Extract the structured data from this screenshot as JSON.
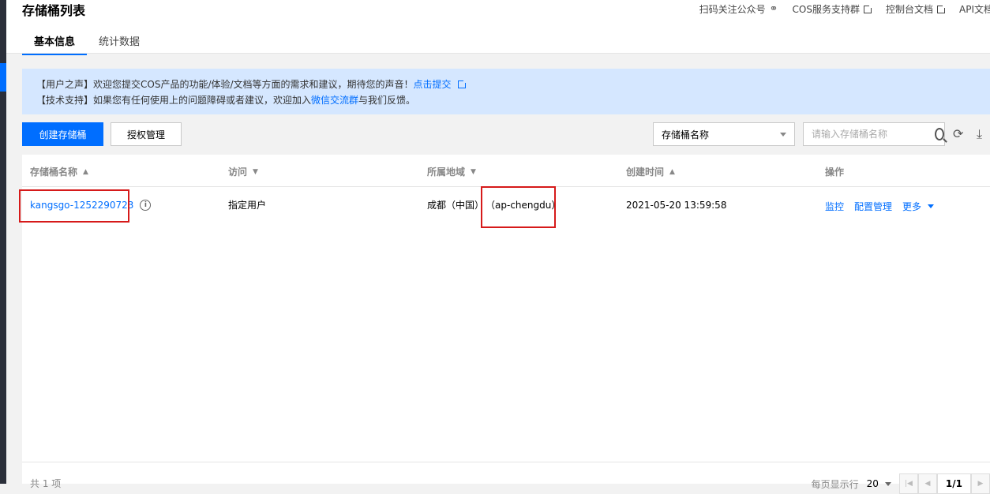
{
  "header": {
    "title": "存储桶列表",
    "links": [
      {
        "label": "扫码关注公众号",
        "icon": "wechat-icon"
      },
      {
        "label": "COS服务支持群",
        "icon": "external-link-icon"
      },
      {
        "label": "控制台文档",
        "icon": "external-link-icon"
      },
      {
        "label": "API文档",
        "icon": ""
      }
    ],
    "tabs": [
      {
        "label": "基本信息",
        "active": true
      },
      {
        "label": "统计数据",
        "active": false
      }
    ]
  },
  "notice": {
    "line1_text": "【用户之声】欢迎您提交COS产品的功能/体验/文档等方面的需求和建议，期待您的声音！",
    "line1_link": "点击提交",
    "line2_prefix": "【技术支持】如果您有任何使用上的问题障碍或者建议，欢迎加入",
    "line2_link": "微信交流群",
    "line2_suffix": "与我们反馈。"
  },
  "toolbar": {
    "create_label": "创建存储桶",
    "auth_label": "授权管理",
    "filter_select": "存储桶名称",
    "search_placeholder": "请输入存储桶名称"
  },
  "table": {
    "columns": [
      "存储桶名称",
      "访问",
      "所属地域",
      "创建时间",
      "操作"
    ],
    "rows": [
      {
        "name": "kangsgo-1252290723",
        "access": "指定用户",
        "region_name": "成都（中国）",
        "region_code": "（ap-chengdu）",
        "created": "2021-05-20 13:59:58",
        "ops": [
          "监控",
          "配置管理",
          "更多"
        ]
      }
    ]
  },
  "footer": {
    "total": "共 1 项",
    "page_size_label": "每页显示行",
    "page_size": "20",
    "page": "1/1"
  },
  "colors": {
    "accent": "#006eff",
    "notice_bg": "#d5e7ff",
    "highlight_box": "#d61a1a"
  }
}
